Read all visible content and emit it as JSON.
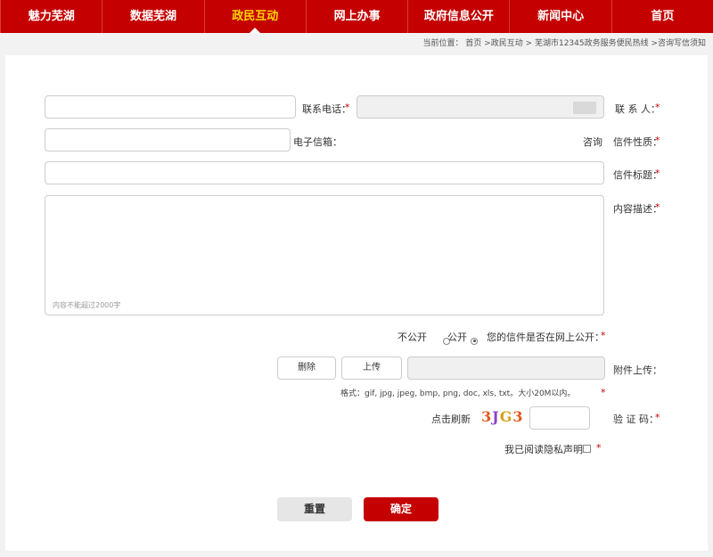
{
  "nav": {
    "items": [
      "首页",
      "新闻中心",
      "政府信息公开",
      "网上办事",
      "政民互动",
      "数据芜湖",
      "魅力芜湖"
    ],
    "active_index": 4
  },
  "breadcrumb": "当前位置： 首页 >政民互动 > 芜湖市12345政务服务便民热线 >咨询写信须知",
  "form": {
    "contact_label": "联 系 人：",
    "phone_label": "联系电话：",
    "type_label": "信件性质：",
    "type_value": "咨询",
    "email_label": "电子信箱：",
    "subject_label": "信件标题：",
    "content_label": "内容描述：",
    "content_hint": "内容不能超过2000字",
    "public_question": "您的信件是否在网上公开：",
    "public_yes": "公开",
    "public_no": "不公开",
    "attach_label": "附件上传：",
    "upload_button": "上传",
    "delete_button": "删除",
    "attach_hint": "格式：gif, jpg, jpeg, bmp, png, doc, xls, txt。大小20M以内。",
    "captcha_label": "验 证 码：",
    "captcha_chars": [
      "3",
      "J",
      "G",
      "3"
    ],
    "captcha_refresh": "点击刷新",
    "agree_label": "我已阅读隐私声明",
    "req_mark": "*"
  },
  "buttons": {
    "submit": "确定",
    "reset": "重置"
  },
  "colors": {
    "brand": "#c50000",
    "active_nav_text": "#ffd700"
  }
}
